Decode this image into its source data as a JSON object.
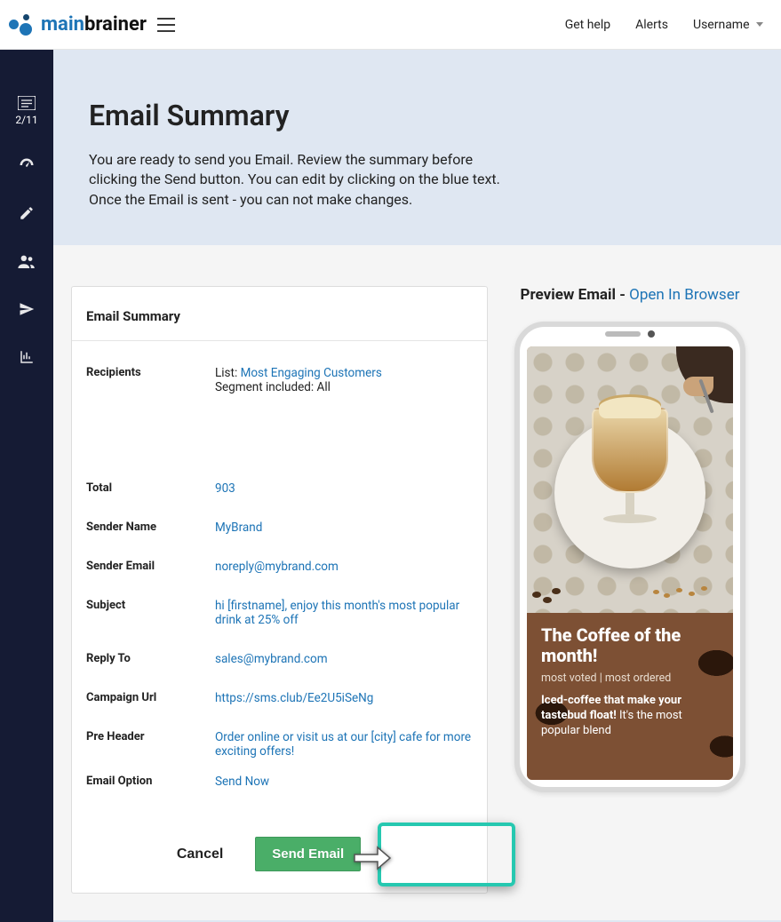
{
  "header": {
    "logo_main": "main",
    "logo_brainer": "brainer",
    "get_help": "Get help",
    "alerts": "Alerts",
    "username": "Username"
  },
  "sidebar": {
    "step_counter": "2/11"
  },
  "hero": {
    "title": "Email Summary",
    "description": "You are ready to send you Email. Review the summary before clicking the Send button. You can edit by clicking on the blue text. Once the Email is sent - you can not make changes."
  },
  "summary": {
    "card_title": "Email Summary",
    "labels": {
      "recipients": "Recipients",
      "total": "Total",
      "sender_name": "Sender Name",
      "sender_email": "Sender Email",
      "subject": "Subject",
      "reply_to": "Reply To",
      "campaign_url": "Campaign Url",
      "pre_header": "Pre Header",
      "email_option": "Email Option"
    },
    "recipients": {
      "list_prefix": "List: ",
      "list_name": "Most Engaging Customers",
      "segment": "Segment included: All"
    },
    "total": "903",
    "sender_name": "MyBrand",
    "sender_email": "noreply@mybrand.com",
    "subject": "hi [firstname], enjoy this month's most popular drink at 25% off",
    "reply_to": "sales@mybrand.com",
    "campaign_url": "https://sms.club/Ee2U5iSeNg",
    "pre_header": "Order online or visit us at our [city] cafe for more exciting offers!",
    "email_option": "Send Now",
    "cancel_label": "Cancel",
    "send_label": "Send Email"
  },
  "preview": {
    "title_prefix": "Preview Email - ",
    "open_link": "Open In Browser",
    "email_heading": "The Coffee of the month!",
    "email_sub": "most voted | most ordered",
    "email_highlight_bold": "Iced-coffee that make your tastebud float!",
    "email_highlight_rest": " It's the most popular blend"
  }
}
